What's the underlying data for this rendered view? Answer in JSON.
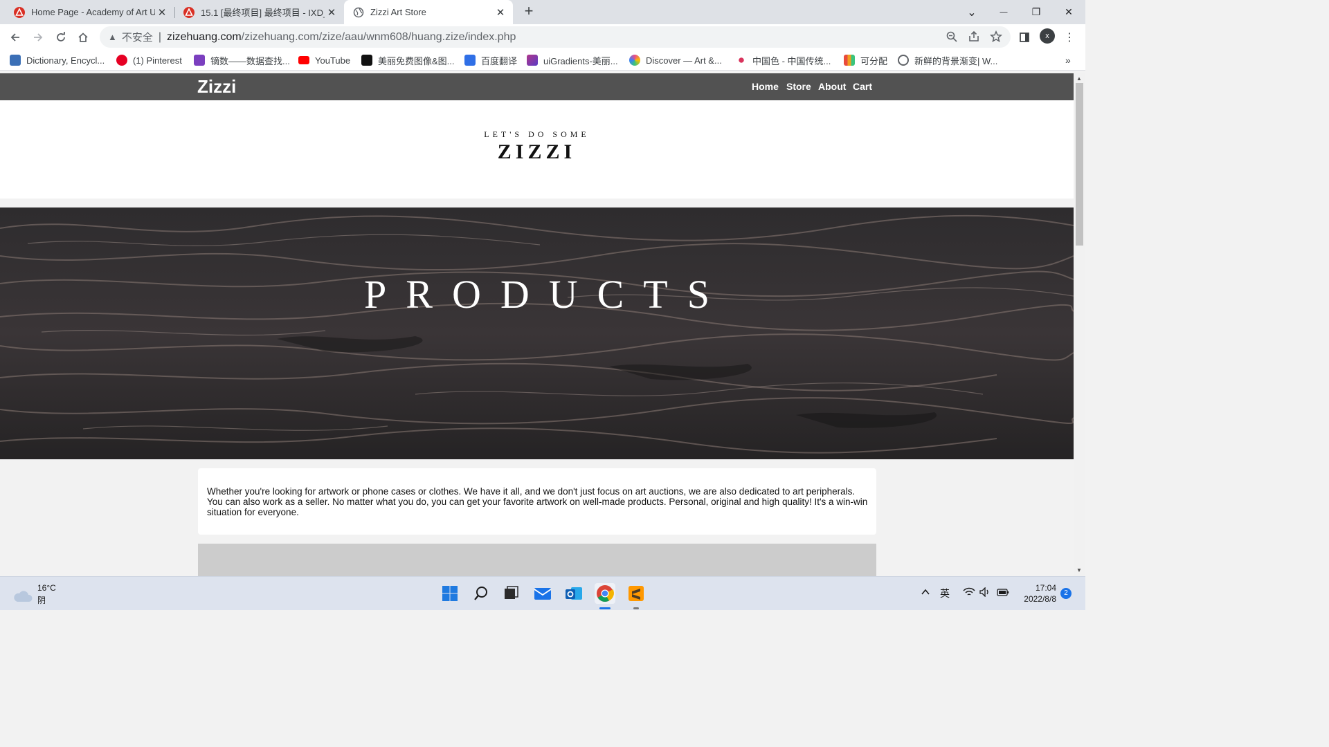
{
  "browser": {
    "tabs": [
      {
        "title": "Home Page - Academy of Art U",
        "favicon": "academy-icon",
        "active": false
      },
      {
        "title": "15.1 [最终项目] 最终项目 - IXD_",
        "favicon": "academy-icon",
        "active": false
      },
      {
        "title": "Zizzi Art Store",
        "favicon": "globe-icon",
        "active": true
      }
    ],
    "new_tab_glyph": "+",
    "close_glyph": "✕",
    "window_controls": {
      "tab_search": "⌄",
      "minimize": "—",
      "restore": "❐",
      "close": "✕"
    },
    "address": {
      "security_label": "不安全",
      "host": "zizehuang.com",
      "path": "/zizehuang.com/zize/aau/wnm608/huang.zize/index.php"
    },
    "profile_initial": "x",
    "bookmarks": [
      {
        "label": "Dictionary, Encycl...",
        "icon": "dictionary-icon",
        "color": "#3b6fb6"
      },
      {
        "label": "(1) Pinterest",
        "icon": "pinterest-icon",
        "color": "#e60023"
      },
      {
        "label": "镝数——数据查找...",
        "icon": "dishu-icon",
        "color": "#7b3fbf"
      },
      {
        "label": "YouTube",
        "icon": "youtube-icon",
        "color": "#ff0000"
      },
      {
        "label": "美丽免费图像&图...",
        "icon": "unsplash-icon",
        "color": "#111111"
      },
      {
        "label": "百度翻译",
        "icon": "baidu-translate-icon",
        "color": "#2f6fe6"
      },
      {
        "label": "uiGradients-美丽...",
        "icon": "uigradients-icon",
        "color": "#b0368a"
      },
      {
        "label": "Discover — Art &...",
        "icon": "dribbble-icon",
        "color": "#ea4c89"
      },
      {
        "label": "中国色 - 中国传统...",
        "icon": "zhongguose-icon",
        "color": "#d9335c"
      },
      {
        "label": "可分配",
        "icon": "kefenpei-icon",
        "color": "#f0a020"
      },
      {
        "label": "新鲜的背景渐变| W...",
        "icon": "globe-icon",
        "color": "#5f6368"
      }
    ],
    "more_bookmarks": "»"
  },
  "site": {
    "brand": "Zizzi",
    "nav": [
      "Home",
      "Store",
      "About",
      "Cart"
    ],
    "tagline": "LET'S DO SOME",
    "headline": "ZIZZI",
    "banner_title": "PRODUCTS",
    "intro": "Whether you're looking for artwork or phone cases or clothes. We have it all, and we don't just focus on art auctions, we are also dedicated to art peripherals. You can also work as a seller. No matter what you do, you can get your favorite artwork on well-made products. Personal, original and high quality! It's a win-win situation for everyone."
  },
  "taskbar": {
    "weather_temp": "16°C",
    "weather_desc": "阴",
    "ime": "英",
    "time": "17:04",
    "date": "2022/8/8",
    "notifications": "2"
  },
  "colors": {
    "navbar": "#525252",
    "banner": "#2b2a2b",
    "page_bg": "#f2f2f2"
  }
}
